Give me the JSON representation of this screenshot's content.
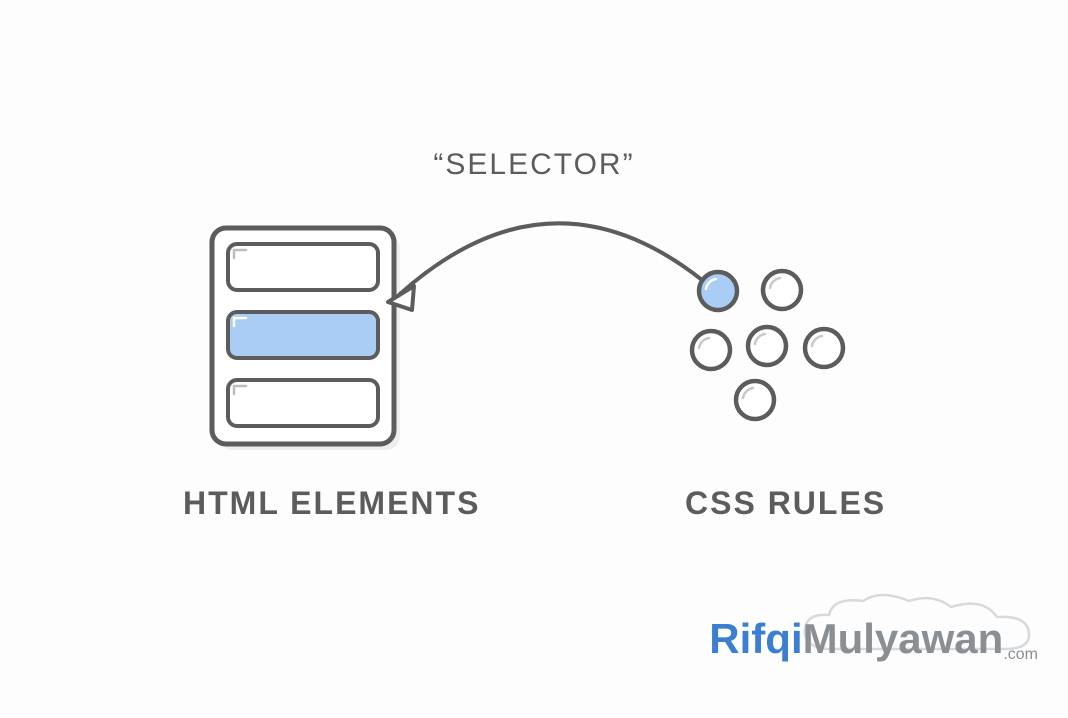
{
  "title": "“SELECTOR”",
  "left_label": "HTML ELEMENTS",
  "right_label": "CSS RULES",
  "watermark": {
    "part1": "Rifqi",
    "part2": "Mulyawan",
    "part3": ".com"
  },
  "colors": {
    "stroke": "#5c5c5c",
    "highlight": "#a9cdf4",
    "bg": "#ffffff"
  }
}
